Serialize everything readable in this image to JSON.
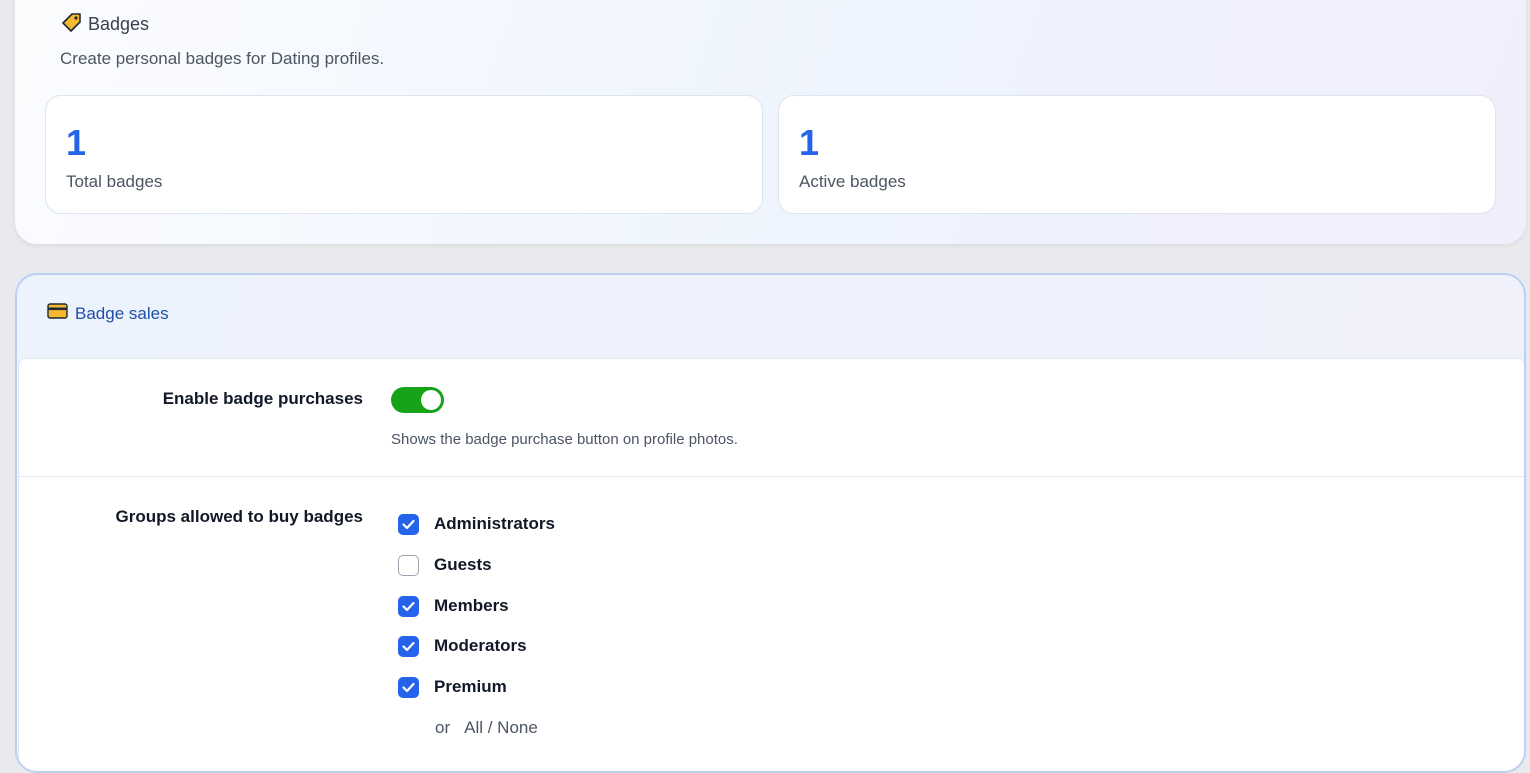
{
  "badges": {
    "title": "Badges",
    "description": "Create personal badges for Dating profiles.",
    "stats": [
      {
        "value": "1",
        "label": "Total badges"
      },
      {
        "value": "1",
        "label": "Active badges"
      }
    ]
  },
  "sales": {
    "title": "Badge sales",
    "enable_label": "Enable badge purchases",
    "enable_on": true,
    "enable_hint": "Shows the badge purchase button on profile photos.",
    "groups_label": "Groups allowed to buy badges",
    "groups": [
      {
        "name": "Administrators",
        "checked": true
      },
      {
        "name": "Guests",
        "checked": false
      },
      {
        "name": "Members",
        "checked": true
      },
      {
        "name": "Moderators",
        "checked": true
      },
      {
        "name": "Premium",
        "checked": true
      }
    ],
    "or_text": "or",
    "all_none_text": "All / None"
  },
  "colors": {
    "accent": "#2563eb",
    "toggle_on": "#16a31a"
  }
}
